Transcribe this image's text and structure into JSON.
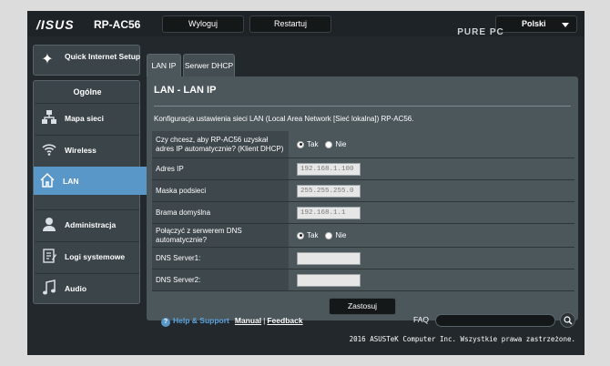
{
  "header": {
    "brand": "/ISUS",
    "model": "RP-AC56",
    "logout_label": "Wyloguj",
    "restart_label": "Restartuj",
    "language": "Polski",
    "watermark_line1": "PURE PC"
  },
  "sidebar": {
    "quick_setup_label": "Quick Internet Setup",
    "section_title": "Ogólne",
    "items": [
      {
        "label": "Mapa sieci",
        "icon": "network-map-icon"
      },
      {
        "label": "Wireless",
        "icon": "wifi-icon"
      },
      {
        "label": "LAN",
        "icon": "home-icon"
      },
      {
        "label": "Administracja",
        "icon": "admin-user-icon"
      },
      {
        "label": "Logi systemowe",
        "icon": "log-icon"
      },
      {
        "label": "Audio",
        "icon": "music-note-icon"
      }
    ],
    "active_item": "LAN"
  },
  "tabs": [
    {
      "label": "LAN IP"
    },
    {
      "label": "Serwer DHCP"
    }
  ],
  "panel": {
    "title": "LAN - LAN IP",
    "description": "Konfiguracja ustawienia sieci LAN (Local Area Network [Sieć lokalna]) RP-AC56.",
    "rows": {
      "auto_ip": {
        "label": "Czy chcesz, aby RP-AC56 uzyskał adres IP automatycznie? (Klient DHCP)",
        "yes": "Tak",
        "no": "Nie",
        "selected": "Tak"
      },
      "ip_address": {
        "label": "Adres IP",
        "value": "192.168.1.100"
      },
      "subnet_mask": {
        "label": "Maska podsieci",
        "value": "255.255.255.0"
      },
      "gateway": {
        "label": "Brama domyślna",
        "value": "192.168.1.1"
      },
      "dns_auto": {
        "label": "Połączyć z serwerem DNS automatycznie?",
        "yes": "Tak",
        "no": "Nie",
        "selected": "Tak"
      },
      "dns1": {
        "label": "DNS Server1:",
        "value": ""
      },
      "dns2": {
        "label": "DNS Server2:",
        "value": ""
      }
    },
    "apply_label": "Zastosuj"
  },
  "footer": {
    "help_label": "Help & Support",
    "manual_label": "Manual",
    "separator": "|",
    "feedback_label": "Feedback",
    "faq_label": "FAQ",
    "copyright": "2016 ASUSTeK Computer Inc. Wszystkie prawa zastrzeżone."
  },
  "colors": {
    "accent": "#5a97c9",
    "background": "#22282b",
    "panel": "#4c575c",
    "help_link": "#5ba4df"
  }
}
